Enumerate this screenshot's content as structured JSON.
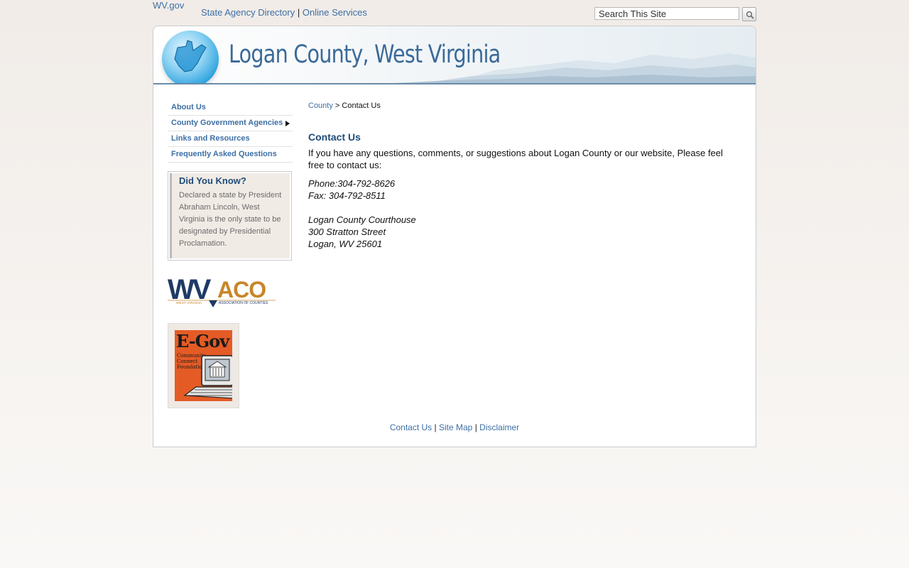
{
  "topbar": {
    "logo_alt": "WV.gov",
    "links": [
      "State Agency Directory",
      "Online Services"
    ],
    "separator": "|",
    "search_value": "Search This Site"
  },
  "banner": {
    "title": "Logan County, West Virginia"
  },
  "sidebar": {
    "items": [
      {
        "label": "About Us"
      },
      {
        "label": "County Government Agencies"
      },
      {
        "label": "Links and Resources"
      },
      {
        "label": "Frequently Asked Questions"
      }
    ],
    "did_you_know": {
      "title": "Did You Know?",
      "text": "Declared a state by President Abraham Lincoln, West Virginia is the only state to be designated by Presidential Proclamation."
    },
    "wvaco": {
      "letters_wv": "WV",
      "letters_aco": "ACO",
      "caption_left": "WEST VIRGINIA",
      "caption_right": "ASSOCIATION OF COUNTIES"
    },
    "egov": {
      "title": "E-Gov",
      "line1": "Community",
      "line2": "Connect",
      "line3": "Foundation"
    }
  },
  "main": {
    "breadcrumb": {
      "link": "County",
      "sep": ">",
      "current": "Contact Us"
    },
    "title": "Contact Us",
    "intro": "If you have any questions, comments, or suggestions about Logan County or our website, Please feel free to contact us:",
    "phone": "Phone:304-792-8626",
    "fax": "Fax: 304-792-8511",
    "address": [
      "Logan County Courthouse",
      "300 Stratton Street",
      "Logan, WV 25601"
    ]
  },
  "footer": {
    "links": [
      "Contact Us",
      "Site Map",
      "Disclaimer"
    ],
    "separator": "|"
  },
  "colors": {
    "link": "#3d6fa5",
    "heading": "#1e4c78",
    "wvaco_navy": "#1f3a66",
    "wvaco_gold": "#c8862a",
    "egov_orange": "#e45b26"
  }
}
